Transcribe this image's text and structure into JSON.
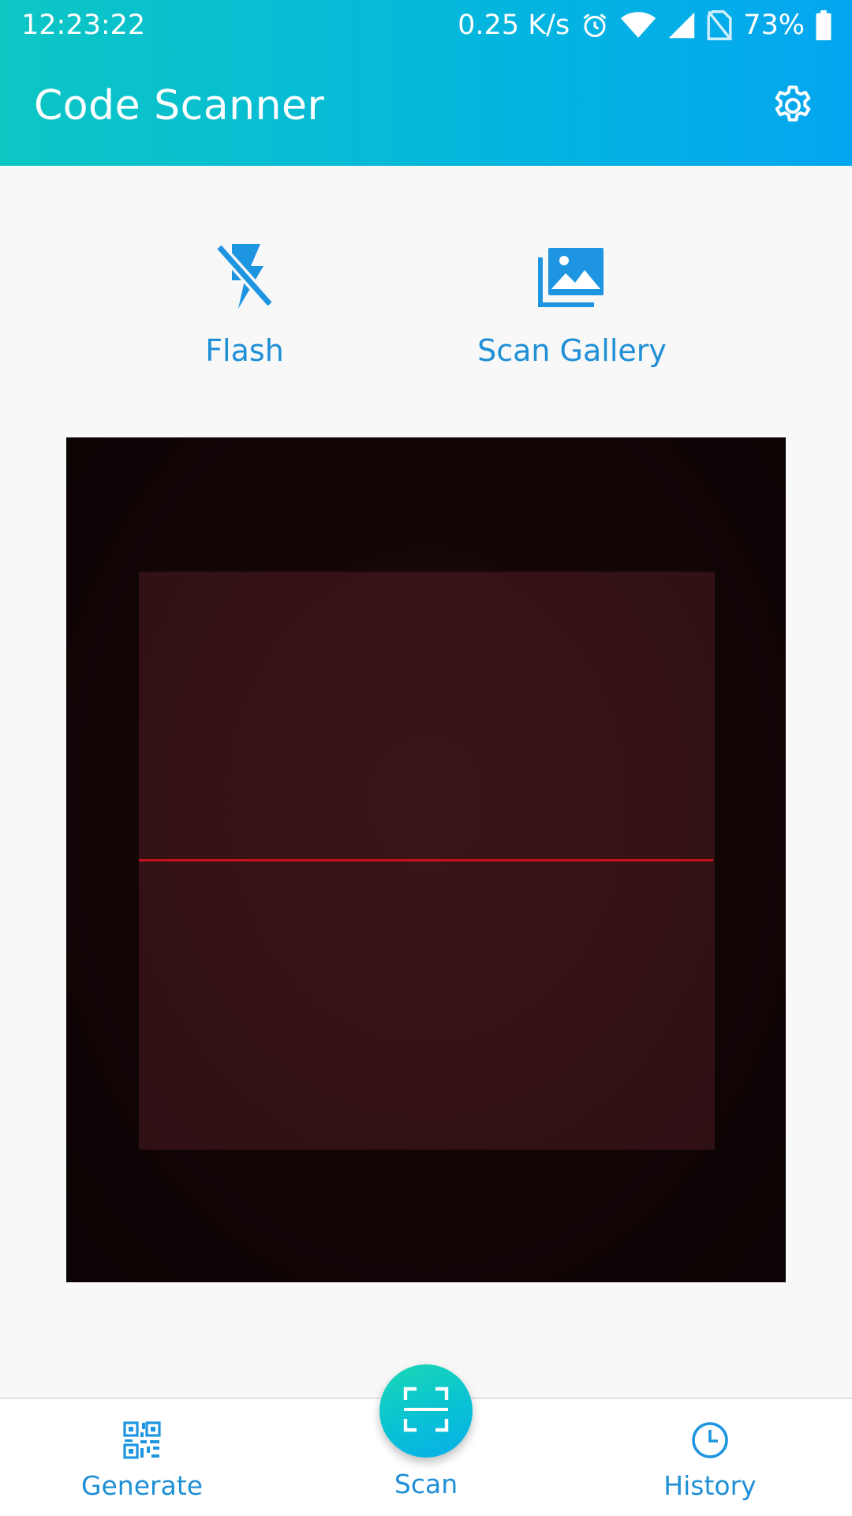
{
  "status_bar": {
    "time": "12:23:22",
    "network_speed": "0.25 K/s",
    "battery": "73%",
    "icons": [
      "alarm-icon",
      "wifi-icon",
      "signal-icon",
      "no-sim-icon",
      "battery-icon"
    ]
  },
  "header": {
    "title": "Code Scanner",
    "settings_icon": "gear-icon"
  },
  "actions": {
    "flash_label": "Flash",
    "gallery_label": "Scan Gallery"
  },
  "bottom_nav": {
    "generate_label": "Generate",
    "scan_label": "Scan",
    "history_label": "History"
  },
  "colors": {
    "header_start": "#0cc6c4",
    "header_end": "#04a6f0",
    "accent_blue": "#1f8fd6",
    "scan_line": "#c8101c"
  }
}
